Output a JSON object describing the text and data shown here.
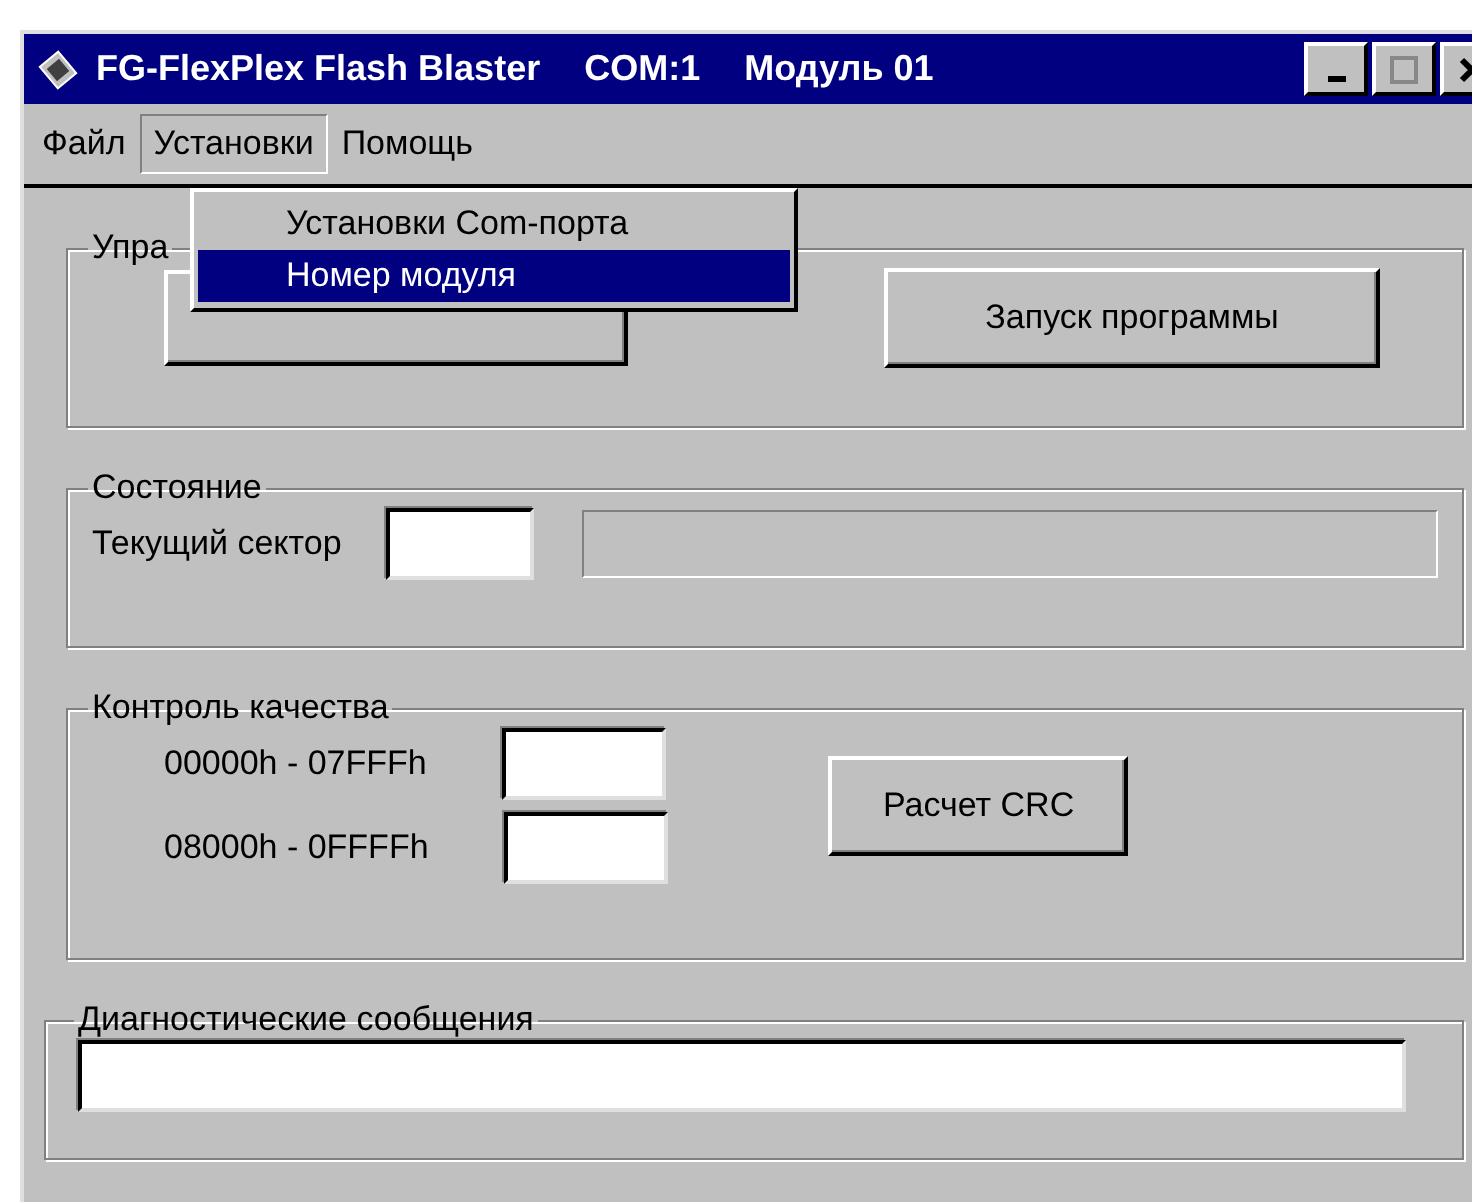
{
  "window": {
    "title": "FG-FlexPlex Flash Blaster",
    "port": "COM:1",
    "module": "Модуль 01"
  },
  "menu": [
    {
      "label": "Файл",
      "selected": false
    },
    {
      "label": "Установки",
      "selected": true
    },
    {
      "label": "Помощь",
      "selected": false
    }
  ],
  "dropdown": [
    {
      "label": "Установки Com-порта",
      "selected": false
    },
    {
      "label": "Номер модуля",
      "selected": true
    }
  ],
  "control_group": {
    "title": "Упра",
    "run_button": "Запуск программы"
  },
  "status_group": {
    "title": "Состояние",
    "sector_label": "Текущий сектор"
  },
  "quality_group": {
    "title": "Контроль качества",
    "ranges": [
      "00000h - 07FFFh",
      "08000h - 0FFFFh"
    ],
    "crc_button": "Расчет CRC"
  },
  "diagnostics_group": {
    "title": "Диагностические сообщения"
  }
}
